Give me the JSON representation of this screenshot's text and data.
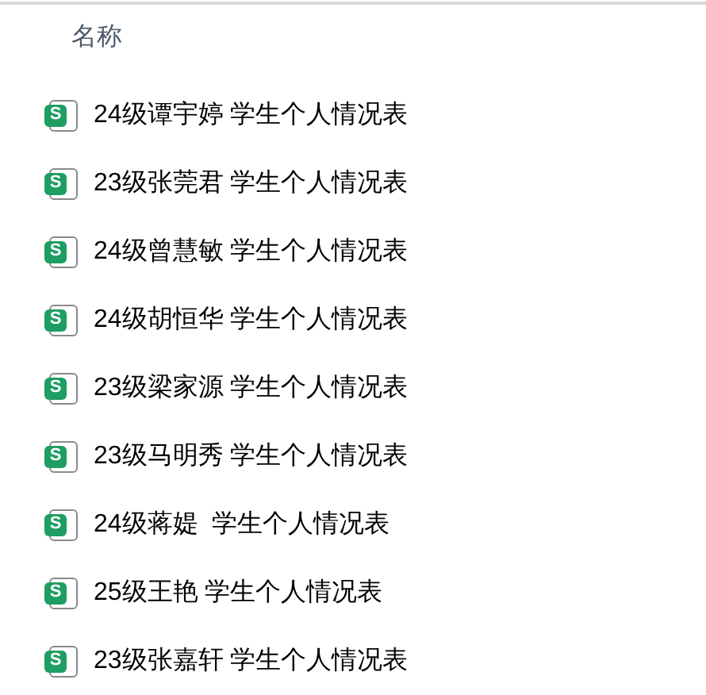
{
  "column_header": "名称",
  "files": [
    {
      "icon_letter": "S",
      "name": "24级谭宇婷 学生个人情况表"
    },
    {
      "icon_letter": "S",
      "name": "23级张莞君 学生个人情况表"
    },
    {
      "icon_letter": "S",
      "name": "24级曾慧敏 学生个人情况表"
    },
    {
      "icon_letter": "S",
      "name": "24级胡恒华 学生个人情况表"
    },
    {
      "icon_letter": "S",
      "name": "23级梁家源 学生个人情况表"
    },
    {
      "icon_letter": "S",
      "name": "23级马明秀 学生个人情况表"
    },
    {
      "icon_letter": "S",
      "name": "24级蒋媞  学生个人情况表"
    },
    {
      "icon_letter": "S",
      "name": "25级王艳 学生个人情况表"
    },
    {
      "icon_letter": "S",
      "name": "23级张嘉轩 学生个人情况表"
    }
  ]
}
